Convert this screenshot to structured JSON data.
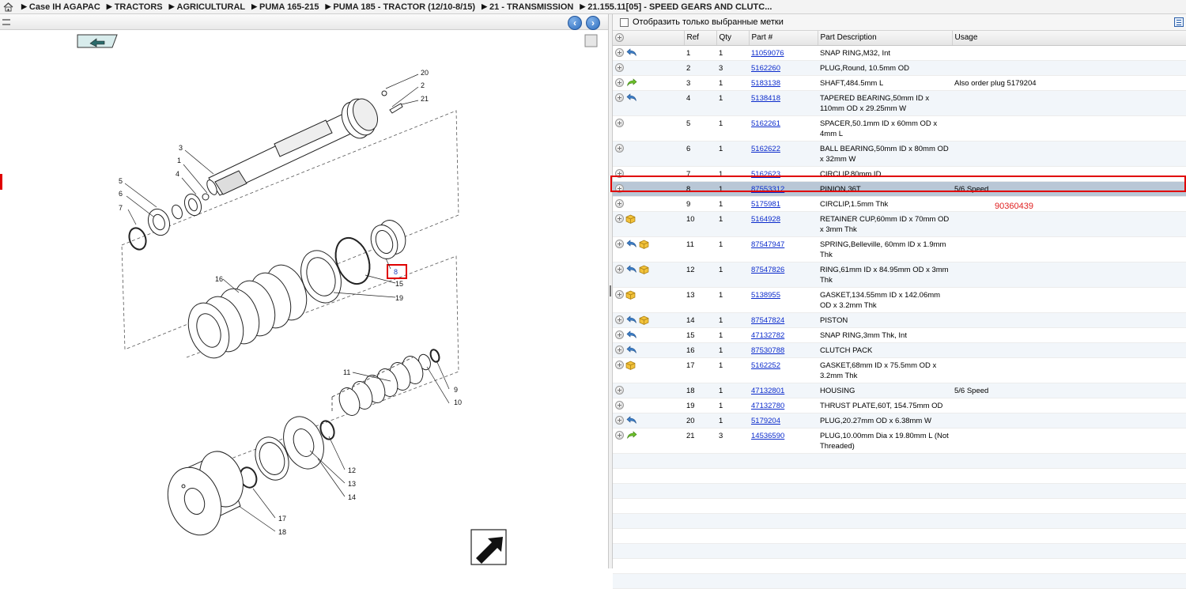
{
  "breadcrumb": {
    "items": [
      "Case IH AGAPAC",
      "TRACTORS",
      "AGRICULTURAL",
      "PUMA 165-215",
      "PUMA 185 - TRACTOR (12/10-8/15)",
      "21 - TRANSMISSION",
      "21.155.11[05] - SPEED GEARS AND CLUTC..."
    ]
  },
  "filter": {
    "label": "Отобразить только выбранные метки",
    "checked": false
  },
  "table": {
    "headers": {
      "ref": "Ref",
      "qty": "Qty",
      "part": "Part #",
      "description": "Part Description",
      "usage": "Usage"
    },
    "rows": [
      {
        "ref": "1",
        "qty": "1",
        "part": "11059076",
        "desc": "SNAP RING,M32, Int",
        "usage": "",
        "icons": [
          "undo-icon"
        ]
      },
      {
        "ref": "2",
        "qty": "3",
        "part": "5162260",
        "desc": "PLUG,Round, 10.5mm OD",
        "usage": "",
        "icons": []
      },
      {
        "ref": "3",
        "qty": "1",
        "part": "5183138",
        "desc": "SHAFT,484.5mm L",
        "usage": "Also order plug 5179204",
        "icons": [
          "forward-icon"
        ]
      },
      {
        "ref": "4",
        "qty": "1",
        "part": "5138418",
        "desc": "TAPERED BEARING,50mm ID x 110mm OD x 29.25mm W",
        "usage": "",
        "icons": [
          "undo-icon"
        ]
      },
      {
        "ref": "5",
        "qty": "1",
        "part": "5162261",
        "desc": "SPACER,50.1mm ID x 60mm OD x 4mm L",
        "usage": "",
        "icons": []
      },
      {
        "ref": "6",
        "qty": "1",
        "part": "5162622",
        "desc": "BALL BEARING,50mm ID x 80mm OD x 32mm W",
        "usage": "",
        "icons": []
      },
      {
        "ref": "7",
        "qty": "1",
        "part": "5162623",
        "desc": "CIRCLIP,80mm ID",
        "usage": "",
        "icons": []
      },
      {
        "ref": "8",
        "qty": "1",
        "part": "87553312",
        "desc": "PINION,36T",
        "usage": "5/6 Speed",
        "icons": [],
        "selected": true
      },
      {
        "ref": "9",
        "qty": "1",
        "part": "5175981",
        "desc": "CIRCLIP,1.5mm Thk",
        "usage": "",
        "icons": []
      },
      {
        "ref": "10",
        "qty": "1",
        "part": "5164928",
        "desc": "RETAINER CUP,60mm ID x 70mm OD x 3mm Thk",
        "usage": "",
        "icons": [
          "box-icon"
        ]
      },
      {
        "ref": "11",
        "qty": "1",
        "part": "87547947",
        "desc": "SPRING,Belleville, 60mm ID x 1.9mm Thk",
        "usage": "",
        "icons": [
          "undo-icon",
          "box-icon"
        ]
      },
      {
        "ref": "12",
        "qty": "1",
        "part": "87547826",
        "desc": "RING,61mm ID x 84.95mm OD x 3mm Thk",
        "usage": "",
        "icons": [
          "undo-icon",
          "box-icon"
        ]
      },
      {
        "ref": "13",
        "qty": "1",
        "part": "5138955",
        "desc": "GASKET,134.55mm ID x 142.06mm OD x 3.2mm Thk",
        "usage": "",
        "icons": [
          "box-icon"
        ]
      },
      {
        "ref": "14",
        "qty": "1",
        "part": "87547824",
        "desc": "PISTON",
        "usage": "",
        "icons": [
          "undo-icon",
          "box-icon"
        ]
      },
      {
        "ref": "15",
        "qty": "1",
        "part": "47132782",
        "desc": "SNAP RING,3mm Thk, Int",
        "usage": "",
        "icons": [
          "undo-icon"
        ]
      },
      {
        "ref": "16",
        "qty": "1",
        "part": "87530788",
        "desc": "CLUTCH PACK",
        "usage": "",
        "icons": [
          "undo-icon"
        ]
      },
      {
        "ref": "17",
        "qty": "1",
        "part": "5162252",
        "desc": "GASKET,68mm ID x 75.5mm OD x 3.2mm Thk",
        "usage": "",
        "icons": [
          "box-icon"
        ]
      },
      {
        "ref": "18",
        "qty": "1",
        "part": "47132801",
        "desc": "HOUSING",
        "usage": "5/6 Speed",
        "icons": []
      },
      {
        "ref": "19",
        "qty": "1",
        "part": "47132780",
        "desc": "THRUST PLATE,60T, 154.75mm OD",
        "usage": "",
        "icons": []
      },
      {
        "ref": "20",
        "qty": "1",
        "part": "5179204",
        "desc": "PLUG,20.27mm OD x 6.38mm W",
        "usage": "",
        "icons": [
          "undo-icon"
        ]
      },
      {
        "ref": "21",
        "qty": "3",
        "part": "14536590",
        "desc": "PLUG,10.00mm Dia x 19.80mm L (Not Threaded)",
        "usage": "",
        "icons": [
          "forward-icon"
        ]
      }
    ]
  },
  "annotation": {
    "number": "90360439"
  },
  "diagram": {
    "callouts": [
      "1",
      "2",
      "3",
      "4",
      "5",
      "6",
      "7",
      "8",
      "9",
      "10",
      "11",
      "12",
      "13",
      "14",
      "15",
      "16",
      "17",
      "18",
      "19",
      "20",
      "21"
    ]
  },
  "colors": {
    "highlight": "#e00000",
    "selected_row": "#b9c7d6",
    "link": "#0b2bcc",
    "nav_button": "#2f6fc0"
  }
}
